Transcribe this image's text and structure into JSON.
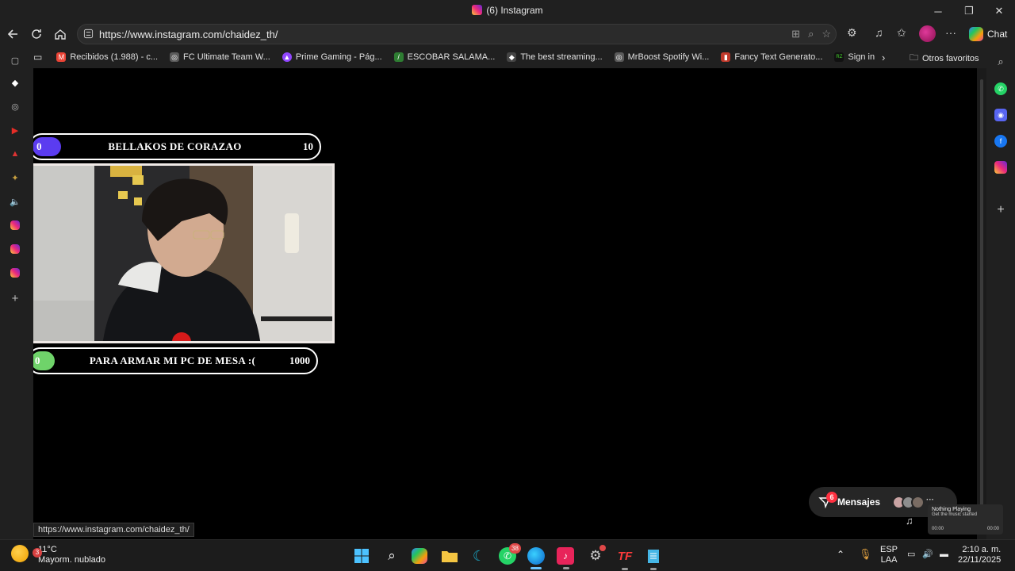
{
  "window": {
    "title": "(6) Instagram",
    "minimize_glyph": "─",
    "maximize_glyph": "❐",
    "close_glyph": "✕"
  },
  "address_bar": {
    "url": "https://www.instagram.com/chaidez_th/",
    "chat_label": "Chat"
  },
  "favorites": [
    {
      "label": "Recibidos (1.988) - c...",
      "icon": "gmail-icon",
      "color": "#ea4335",
      "glyph": "M"
    },
    {
      "label": "FC Ultimate Team W...",
      "icon": "globe-icon",
      "color": "#5a5a5a",
      "glyph": "◎"
    },
    {
      "label": "Prime Gaming - Pág...",
      "icon": "prime-gaming-icon",
      "color": "#9146ff",
      "glyph": "▲"
    },
    {
      "label": "ESCOBAR SALAMA...",
      "icon": "leaf-icon",
      "color": "#2e7d32",
      "glyph": "/"
    },
    {
      "label": "The best streaming...",
      "icon": "diamond-icon",
      "color": "#444",
      "glyph": "◆"
    },
    {
      "label": "MrBoost Spotify Wi...",
      "icon": "globe-icon",
      "color": "#5a5a5a",
      "glyph": "◎"
    },
    {
      "label": "Fancy Text Generato...",
      "icon": "text-generator-icon",
      "color": "#c0392b",
      "glyph": "▮"
    },
    {
      "label": "Sign in",
      "icon": "razer-icon",
      "color": "#111",
      "glyph": "RZ"
    }
  ],
  "other_favorites": "Otros favoritos",
  "overlay": {
    "top_bar": {
      "left_value": "0",
      "label": "BELLAKOS DE CORAZAO",
      "right_value": "10",
      "fill_fraction": 0.1,
      "fill_color": "#5b3cf0"
    },
    "bottom_bar": {
      "left_value": "0",
      "label": "PARA ARMAR MI PC DE MESA :(",
      "right_value": "1000",
      "fill_fraction": 0.0,
      "fill_color": "#6fd36a"
    }
  },
  "messages": {
    "label": "Mensajes",
    "badge": "6",
    "more": "···"
  },
  "music": {
    "title": "Nothing Playing",
    "subtitle": "Get the music started",
    "time_start": "00:00",
    "time_end": "00:00"
  },
  "status_link": "https://www.instagram.com/chaidez_th/",
  "taskbar": {
    "temperature": "11°C",
    "condition": "Mayorm. nublado",
    "weather_badge": "3",
    "whatsapp_badge": "38",
    "lang_top": "ESP",
    "lang_bottom": "LAA",
    "time": "2:10 a. m.",
    "date": "22/11/2025"
  }
}
